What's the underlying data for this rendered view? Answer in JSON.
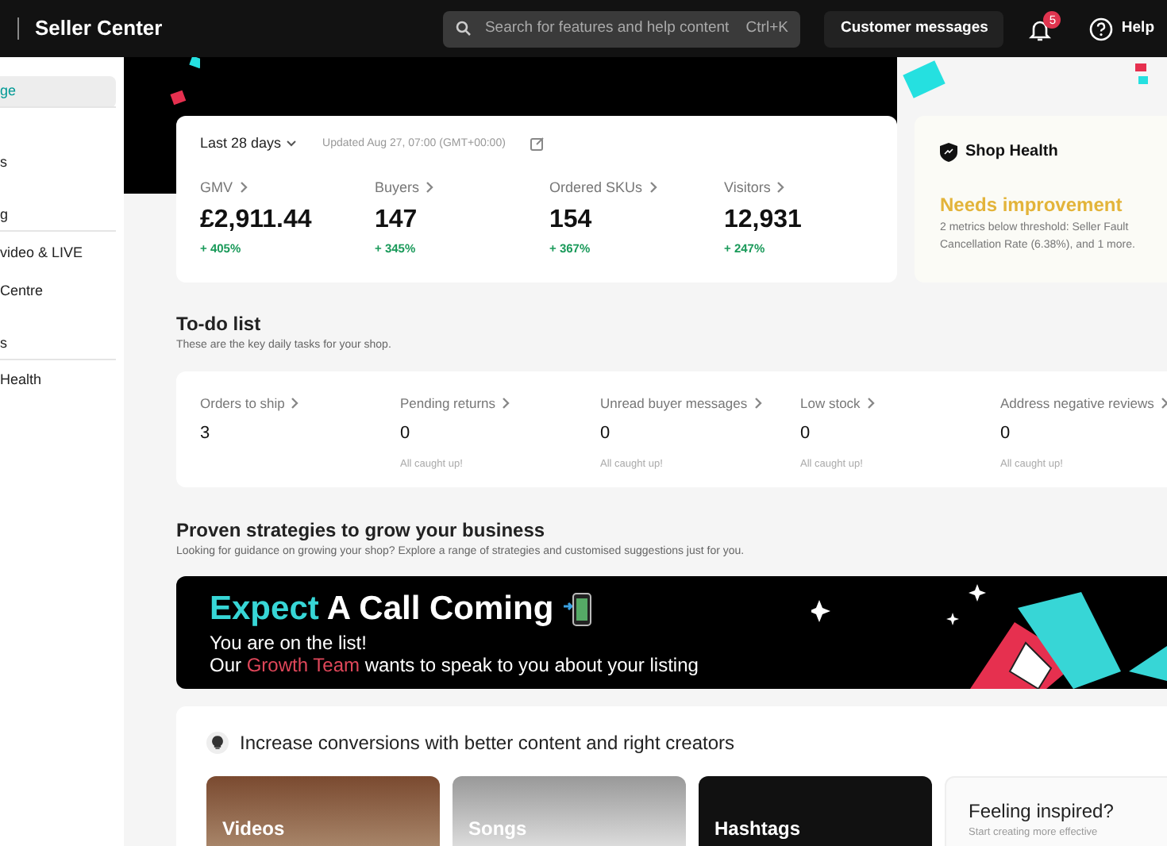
{
  "header": {
    "title": "Seller Center",
    "search_placeholder": "Search for features and help content",
    "search_shortcut": "Ctrl+K",
    "messages_button": "Customer messages",
    "notification_count": "5",
    "help": "Help"
  },
  "sidebar": {
    "items": [
      {
        "label": "ge",
        "selected": true
      },
      {
        "label": "s",
        "selected": false
      },
      {
        "label": "g",
        "selected": false
      },
      {
        "label": "video & LIVE",
        "selected": false
      },
      {
        "label": "Centre",
        "selected": false
      },
      {
        "label": "s",
        "selected": false
      },
      {
        "label": "Health",
        "selected": false
      }
    ]
  },
  "stats": {
    "period": "Last 28 days",
    "updated": "Updated Aug 27, 07:00 (GMT+00:00)",
    "metrics": [
      {
        "label": "GMV",
        "value": "£2,911.44",
        "change": "+ 405%"
      },
      {
        "label": "Buyers",
        "value": "147",
        "change": "+ 345%"
      },
      {
        "label": "Ordered SKUs",
        "value": "154",
        "change": "+ 367%"
      },
      {
        "label": "Visitors",
        "value": "12,931",
        "change": "+ 247%"
      }
    ]
  },
  "shop_health": {
    "title": "Shop Health",
    "status": "Needs improvement",
    "description": "2 metrics below threshold: Seller Fault Cancellation Rate (6.38%), and 1 more."
  },
  "todo": {
    "title": "To-do list",
    "subtitle": "These are the key daily tasks for your shop.",
    "items": [
      {
        "label": "Orders to ship",
        "count": "3"
      },
      {
        "label": "Pending returns",
        "count": "0",
        "note": "All caught up!"
      },
      {
        "label": "Unread buyer messages",
        "count": "0",
        "note": "All caught up!"
      },
      {
        "label": "Low stock",
        "count": "0",
        "note": "All caught up!"
      },
      {
        "label": "Address negative reviews",
        "count": "0",
        "note": "All caught up!"
      }
    ]
  },
  "strategies": {
    "title": "Proven strategies to grow your business",
    "subtitle": "Looking for guidance on growing your shop? Explore a range of strategies and customised suggestions just for you.",
    "banner": {
      "headline": [
        {
          "text": "Expect",
          "highlight": true
        },
        {
          "text": " A Call Coming",
          "highlight": false
        }
      ],
      "line_1": "You are on the list!",
      "line_2": [
        {
          "text": "Our ",
          "highlight": false
        },
        {
          "text": "Growth Team",
          "highlight": true
        },
        {
          "text": " wants to speak to you about your listing",
          "highlight": false
        }
      ]
    }
  },
  "content": {
    "title": "Increase conversions with better content and right creators",
    "tiles": [
      {
        "kind": "photo",
        "label": "Videos"
      },
      {
        "kind": "photo",
        "label": "Songs"
      },
      {
        "kind": "dark",
        "label": "Hashtags"
      },
      {
        "kind": "prompt",
        "label": "Feeling inspired?",
        "subtitle": "Start creating more effective"
      }
    ]
  }
}
